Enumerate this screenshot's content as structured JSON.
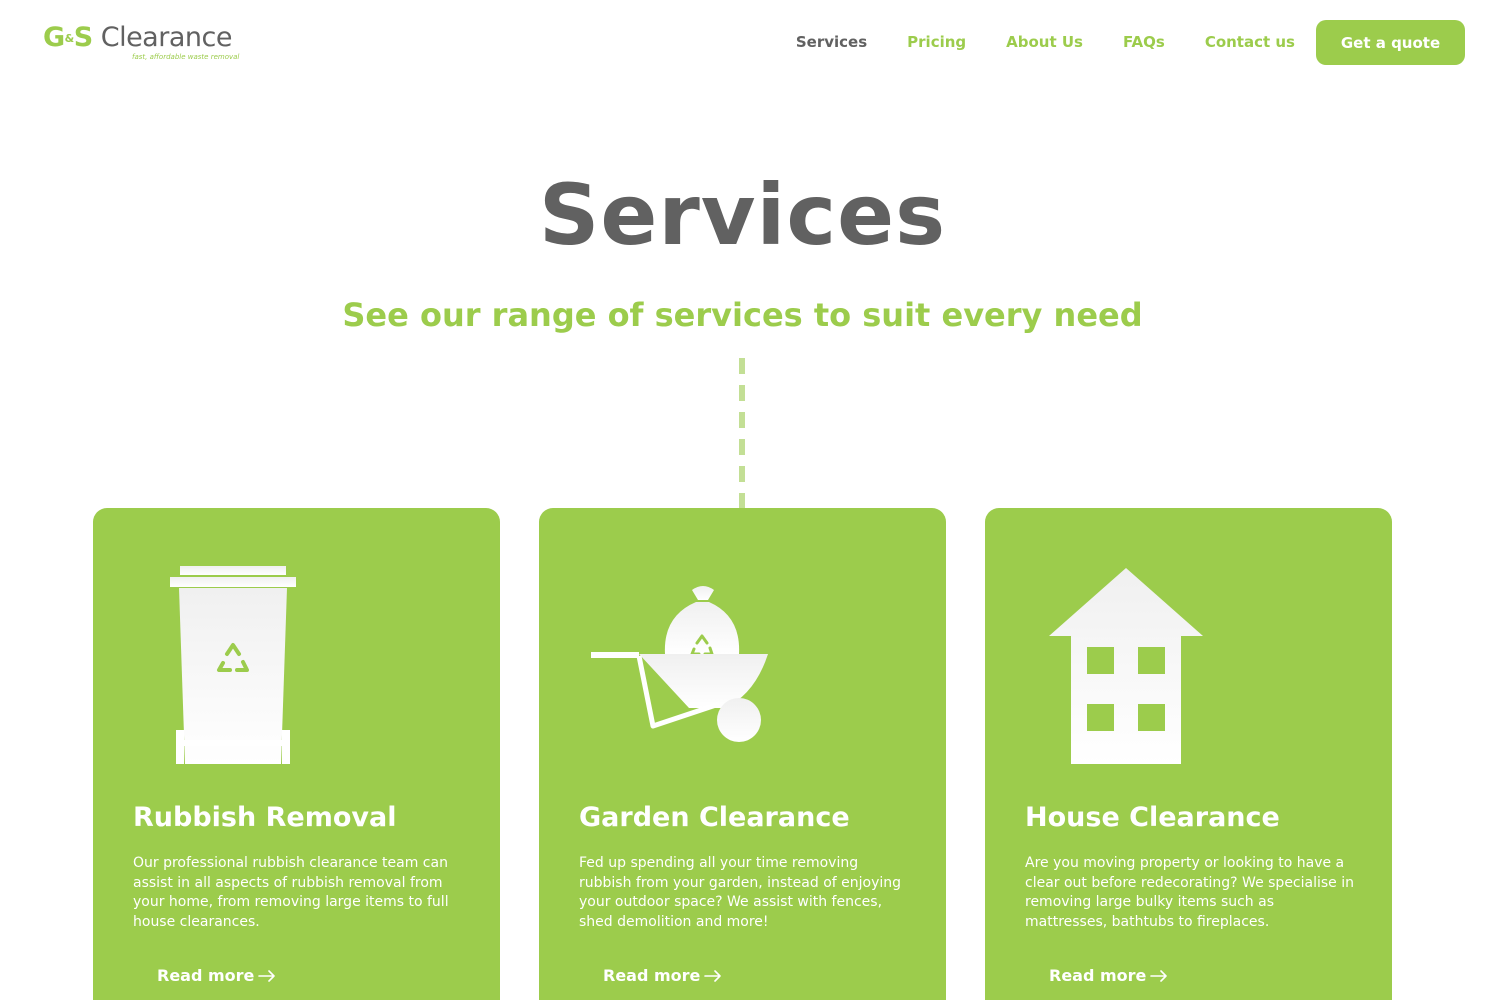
{
  "logo": {
    "g": "G",
    "amp": "&",
    "s": "S",
    "word": "Clearance",
    "tagline": "fast, affordable waste removal"
  },
  "nav": {
    "items": [
      {
        "label": "Services",
        "active": true
      },
      {
        "label": "Pricing",
        "active": false
      },
      {
        "label": "About Us",
        "active": false
      },
      {
        "label": "FAQs",
        "active": false
      },
      {
        "label": "Contact us",
        "active": false
      }
    ],
    "quote_button": "Get a quote"
  },
  "hero": {
    "title": "Services",
    "subtitle": "See our range of services to suit every need"
  },
  "cards": [
    {
      "title": "Rubbish Removal",
      "text": "Our professional rubbish clearance team can assist in all aspects of rubbish removal from your home, from removing large items to full house clearances.",
      "link": "Read more",
      "icon": "wheelie-bin-icon"
    },
    {
      "title": "Garden Clearance",
      "text": "Fed up spending all your time removing rubbish from your garden, instead of enjoying your outdoor space? We assist with fences, shed demolition and more!",
      "link": "Read more",
      "icon": "wheelbarrow-icon"
    },
    {
      "title": "House Clearance",
      "text": "Are you moving property or looking to have a clear out before redecorating? We specialise in removing large bulky items such as mattresses, bathtubs to fireplaces.",
      "link": "Read more",
      "icon": "house-icon"
    }
  ],
  "colors": {
    "brand_green": "#9ccc4c",
    "text_grey": "#616161"
  }
}
